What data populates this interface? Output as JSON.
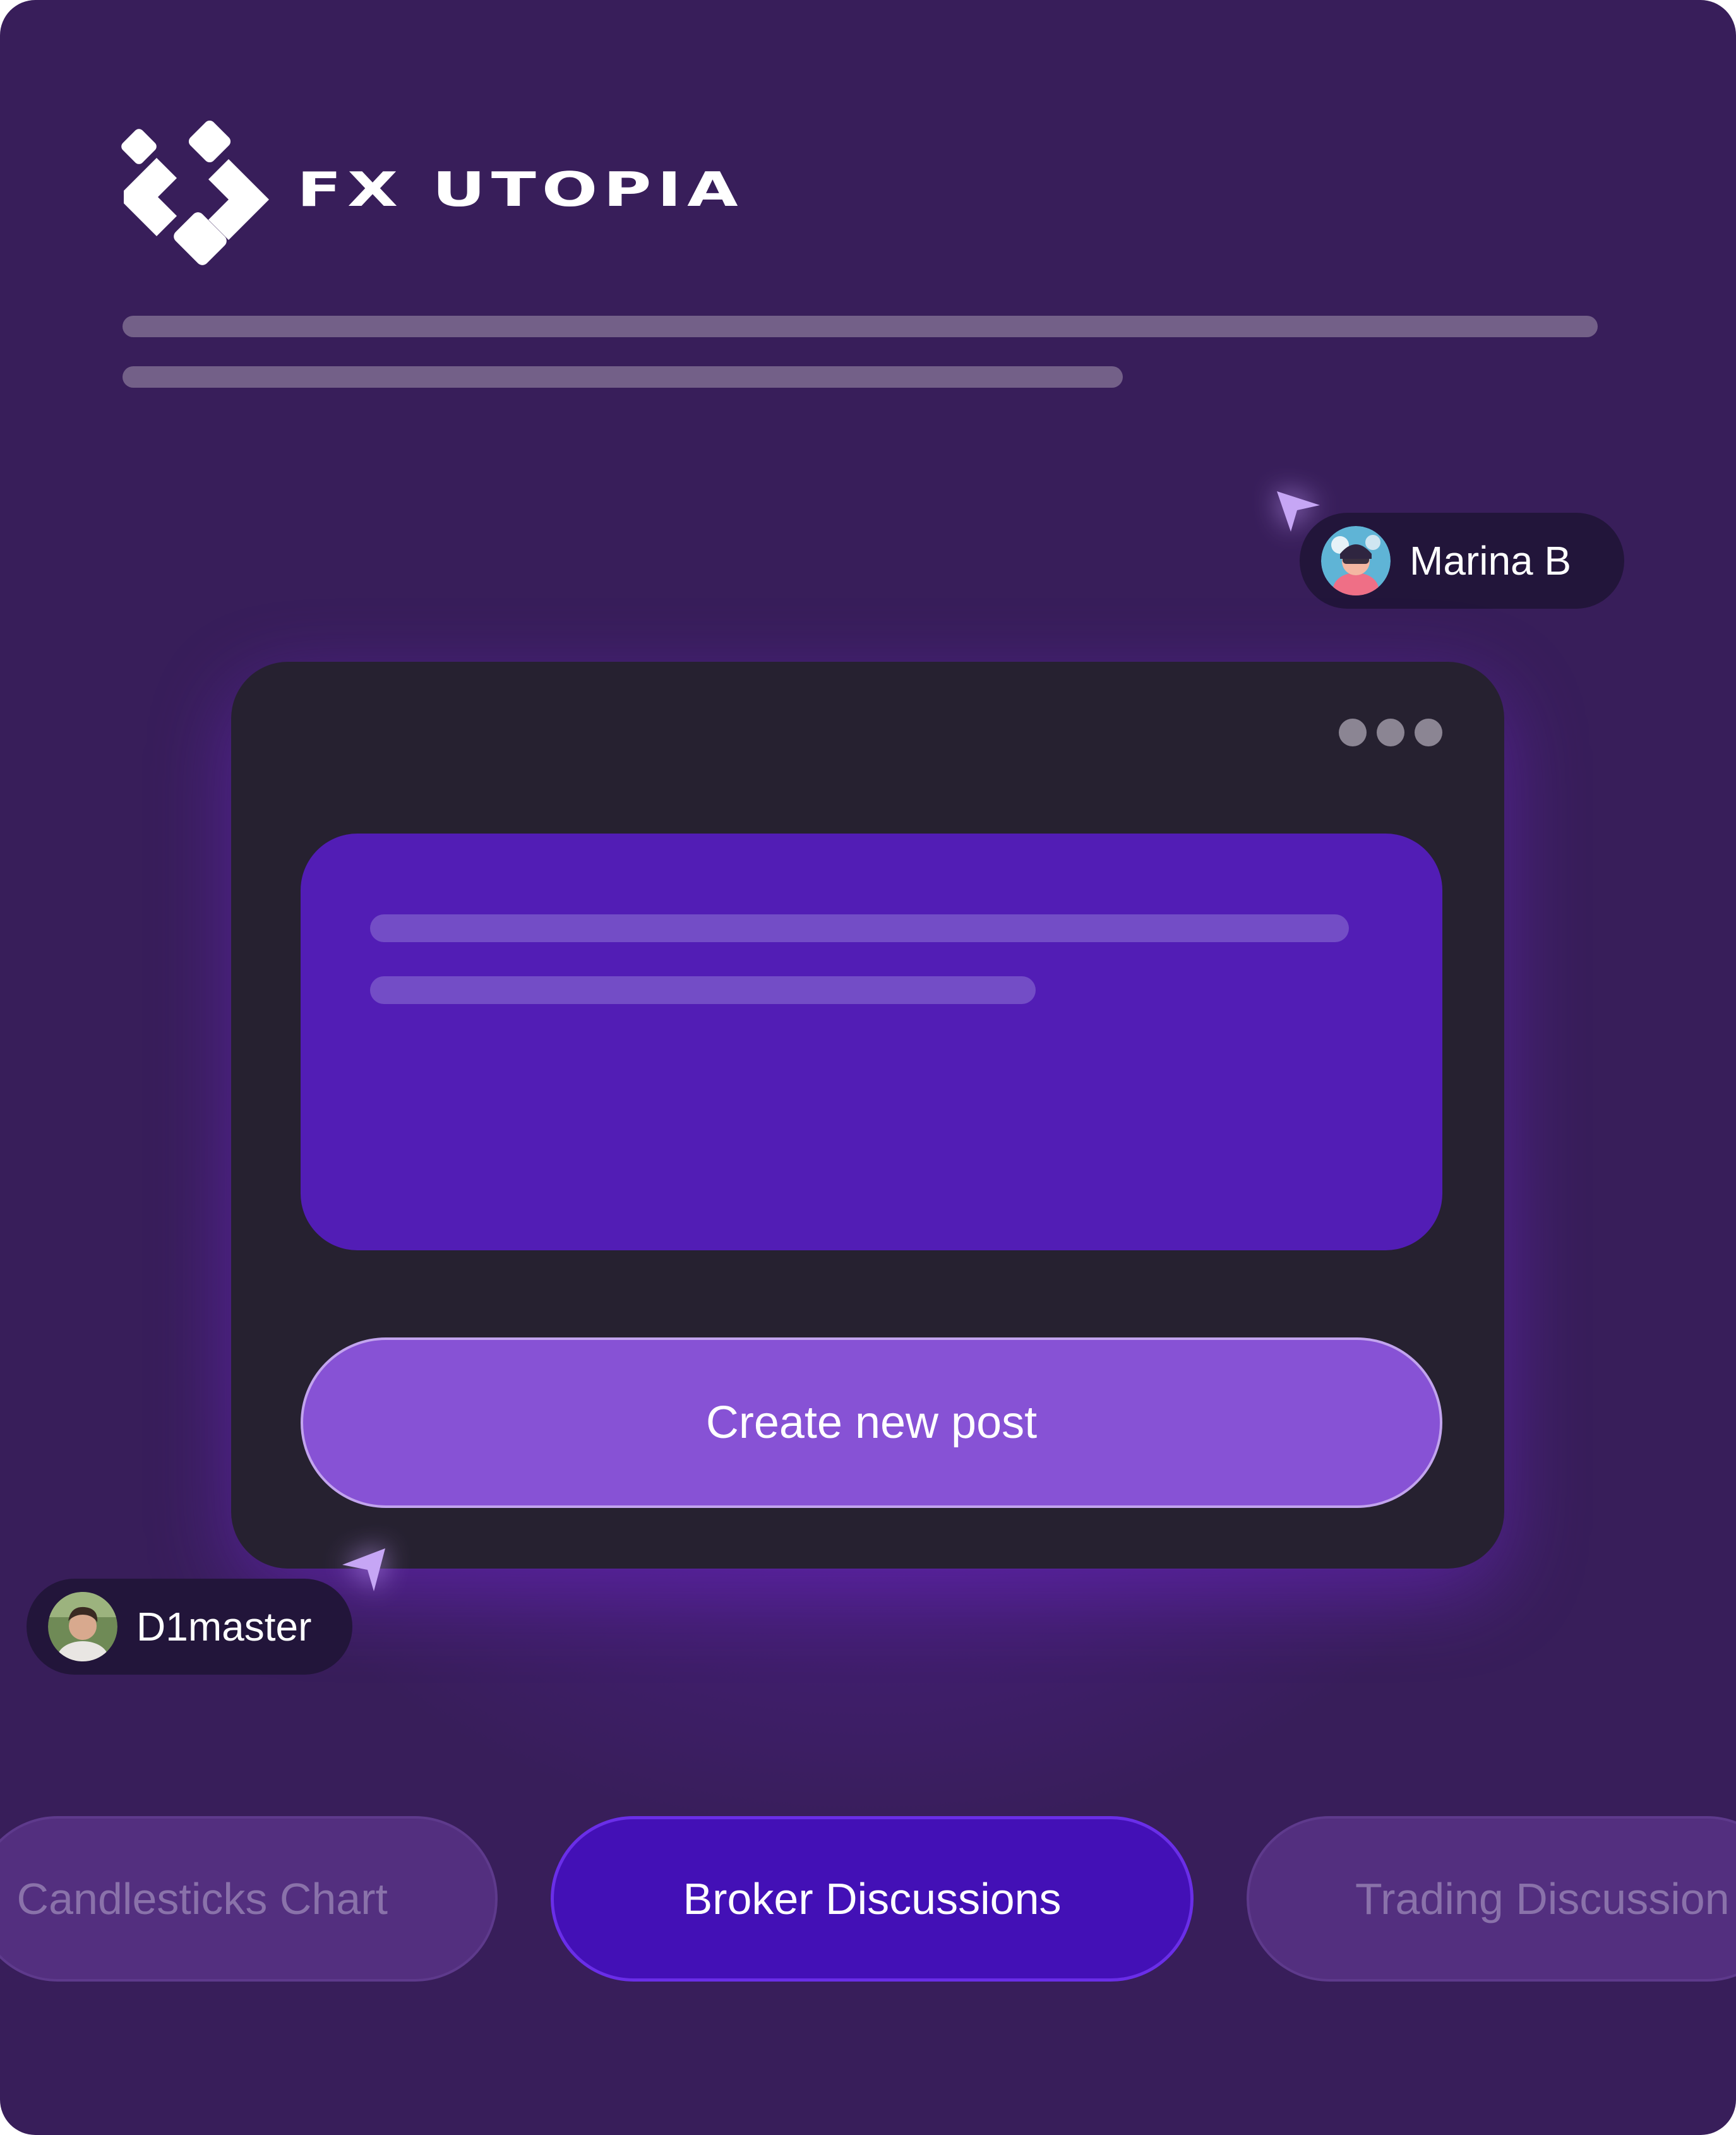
{
  "brand": {
    "name": "FX UTOPIA",
    "colors": {
      "background": "#381e5a",
      "card": "#262130",
      "panel": "#521db5",
      "button": "#8752d5",
      "active_tab": "#4310b6"
    }
  },
  "card": {
    "menu_icon": "more-horizontal-icon",
    "create_button_label": "Create new post"
  },
  "collaborators": [
    {
      "name": "Marina B",
      "cursor_icon": "cursor-arrow-icon"
    },
    {
      "name": "D1master",
      "cursor_icon": "cursor-arrow-icon"
    }
  ],
  "tabs": [
    {
      "label": "Candlesticks Chart",
      "active": false
    },
    {
      "label": "Broker Discussions",
      "active": true
    },
    {
      "label": "Trading Discussion",
      "active": false
    }
  ]
}
